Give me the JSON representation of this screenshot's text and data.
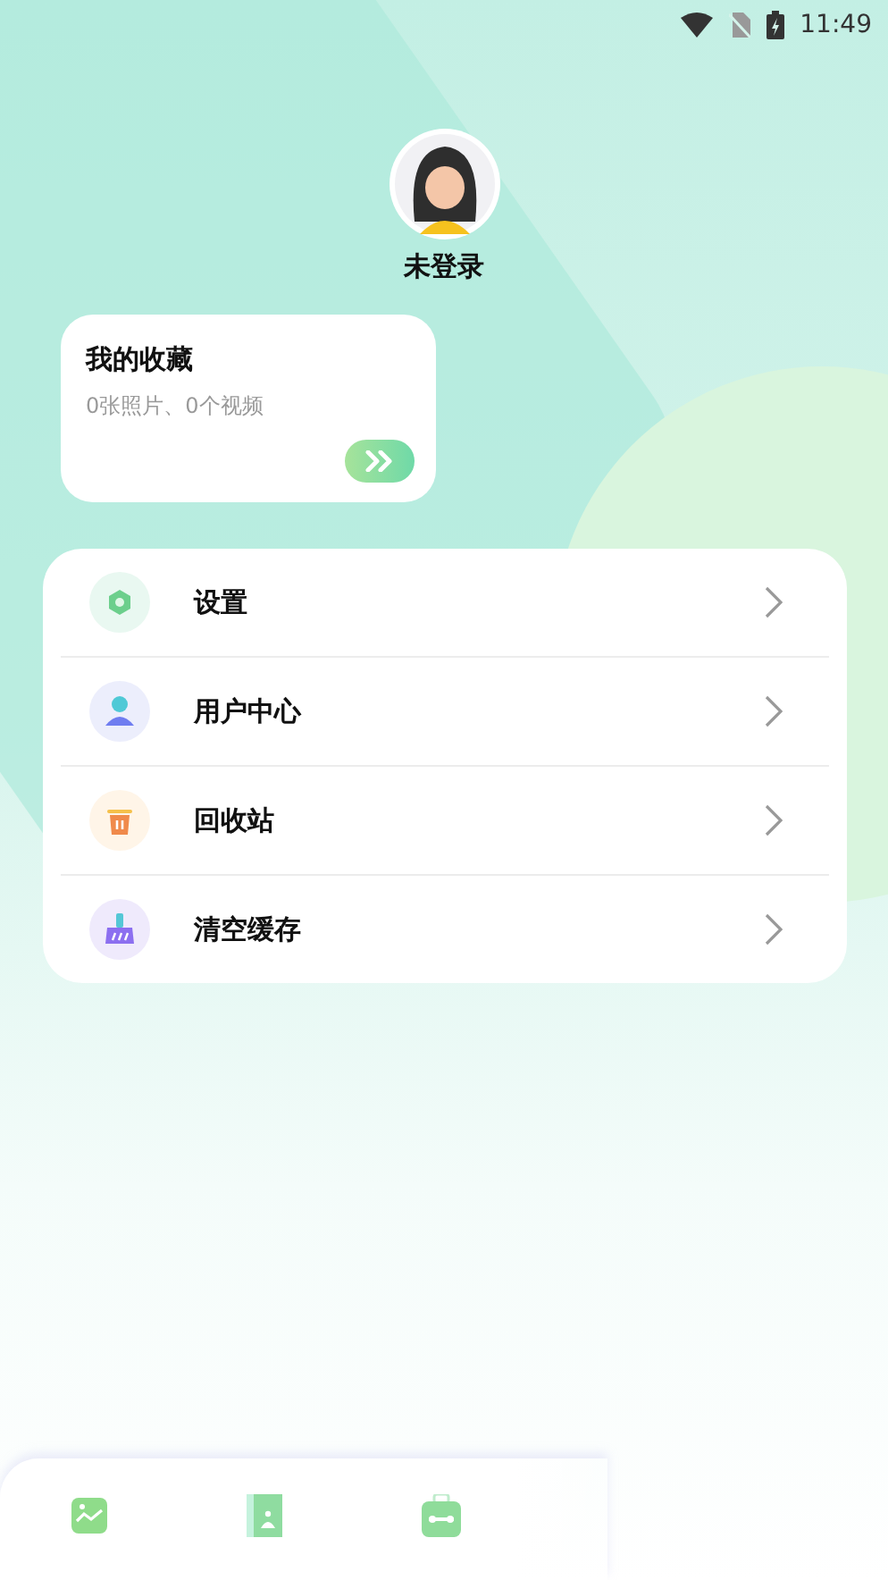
{
  "status_bar": {
    "time": "11:49"
  },
  "profile": {
    "name": "未登录"
  },
  "favorites": {
    "title": "我的收藏",
    "summary": "0张照片、0个视频"
  },
  "menu": [
    {
      "label": "设置"
    },
    {
      "label": "用户中心"
    },
    {
      "label": "回收站"
    },
    {
      "label": "清空缓存"
    }
  ]
}
